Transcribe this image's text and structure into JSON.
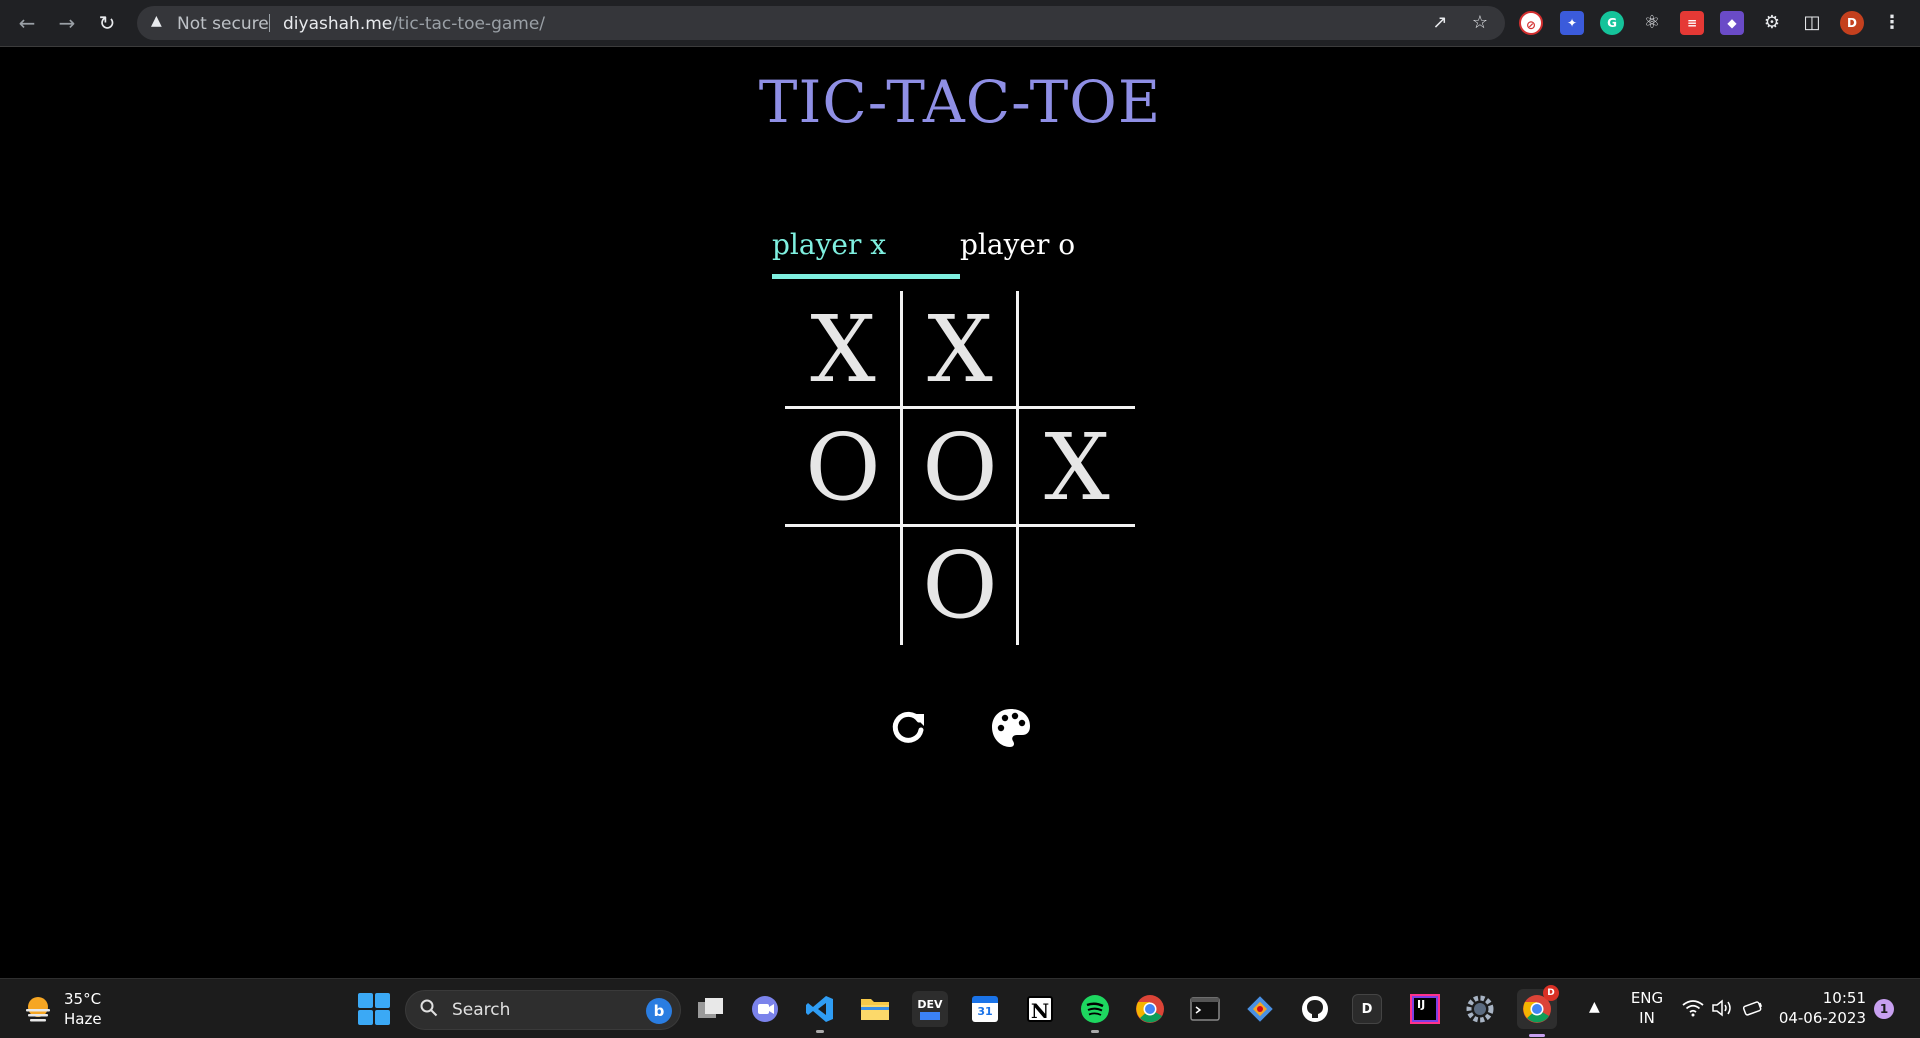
{
  "browser": {
    "security_label": "Not secure",
    "url_host": "diyashah.me",
    "url_path": "/tic-tac-toe-game/",
    "profile_initial": "D"
  },
  "game": {
    "title": "TIC-TAC-TOE",
    "players": {
      "x_label": "player x",
      "o_label": "player o",
      "active": "x"
    },
    "board": [
      "X",
      "X",
      "",
      "O",
      "O",
      "X",
      "",
      "O",
      ""
    ],
    "colors": {
      "title": "#8f8fe5",
      "active_player": "#7ff0e0",
      "marks": "#e6e6e6",
      "background": "#000000"
    },
    "controls": {
      "restart_icon": "restart-icon",
      "theme_icon": "palette-icon"
    }
  },
  "taskbar": {
    "weather": {
      "temp": "35°C",
      "desc": "Haze"
    },
    "search_placeholder": "Search",
    "dev_label": "DEV",
    "calendar_label": "31",
    "notion_label": "N",
    "d_label": "D",
    "ij_label": "IJ",
    "chrome_badge": "D",
    "language": {
      "line1": "ENG",
      "line2": "IN"
    },
    "time": "10:51",
    "date": "04-06-2023",
    "notification_count": "1"
  }
}
